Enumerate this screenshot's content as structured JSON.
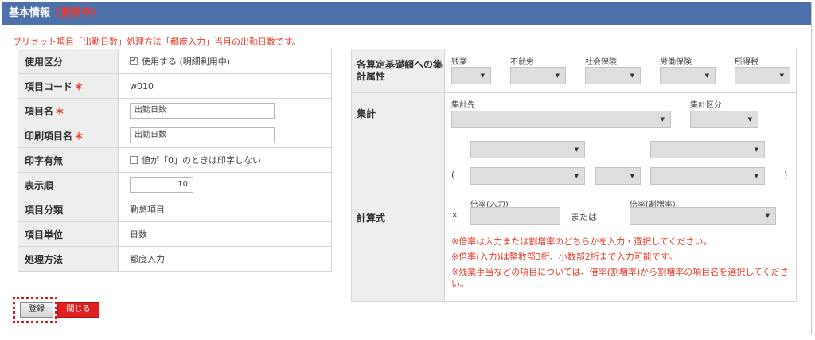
{
  "header": {
    "title": "基本情報",
    "editing_badge": "（更新中）"
  },
  "notice": "プリセット項目「出勤日数」処理方法「都度入力」当月の出勤日数です。",
  "form": {
    "usage": {
      "label": "使用区分",
      "checkbox_label": "使用する (明細利用中)",
      "checked": true
    },
    "code": {
      "label": "項目コード",
      "required_mark": "＊",
      "value": "w010"
    },
    "name": {
      "label": "項目名",
      "required_mark": "＊",
      "value": "出勤日数"
    },
    "print_name": {
      "label": "印刷項目名",
      "required_mark": "＊",
      "value": "出勤日数"
    },
    "print_flag": {
      "label": "印字有無",
      "checkbox_label": "値が「0」のときは印字しない",
      "checked": false
    },
    "display_order": {
      "label": "表示順",
      "value": "10"
    },
    "category": {
      "label": "項目分類",
      "value": "勤怠項目"
    },
    "unit": {
      "label": "項目単位",
      "value": "日数"
    },
    "method": {
      "label": "処理方法",
      "value": "都度入力"
    }
  },
  "attributes": {
    "label": "各算定基礎額への集計属性",
    "fields": [
      {
        "label": "残業"
      },
      {
        "label": "不就労"
      },
      {
        "label": "社会保険"
      },
      {
        "label": "労働保険"
      },
      {
        "label": "所得税"
      }
    ]
  },
  "aggregate": {
    "label": "集計",
    "dest_label": "集計先",
    "type_label": "集計区分"
  },
  "formula": {
    "label": "計算式",
    "open_paren": "(",
    "close_paren": ")",
    "times": "×",
    "rate_input_label": "倍率(入力)",
    "or_text": "または",
    "rate_surcharge_label": "倍率(割増率)",
    "notes": [
      "※倍率は入力または割増率のどちらかを入力・選択してください。",
      "※倍率(入力)は整数部3桁、小数部2桁まで入力可能です。",
      "※残業手当などの項目については、倍率(割増率)から割増率の項目名を選択してください。"
    ]
  },
  "buttons": {
    "save": "登録",
    "close": "閉じる"
  },
  "colors": {
    "header_bg": "#4d6faa",
    "accent_red": "#e8392b",
    "label_bg": "#eeeeee"
  },
  "icons": {
    "dropdown": "chevron-down-icon",
    "checkbox": "checkbox-icon"
  }
}
